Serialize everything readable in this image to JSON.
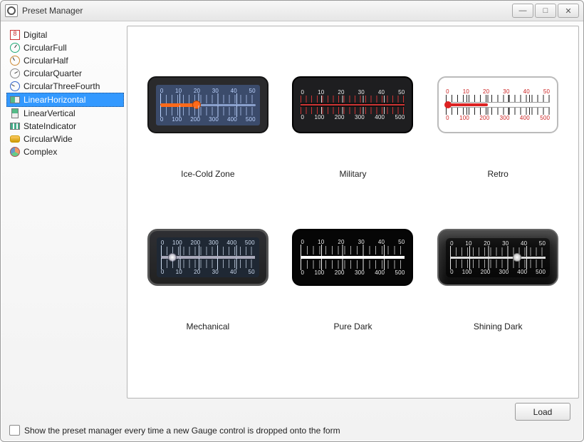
{
  "window": {
    "title": "Preset Manager"
  },
  "win_buttons": {
    "min": "—",
    "max": "□",
    "close": "✕"
  },
  "sidebar": {
    "items": [
      {
        "label": "Digital",
        "icon": "digital-icon"
      },
      {
        "label": "CircularFull",
        "icon": "circular-full-icon"
      },
      {
        "label": "CircularHalf",
        "icon": "circular-half-icon"
      },
      {
        "label": "CircularQuarter",
        "icon": "circular-quarter-icon"
      },
      {
        "label": "CircularThreeFourth",
        "icon": "circular-threefourth-icon"
      },
      {
        "label": "LinearHorizontal",
        "icon": "linear-horizontal-icon",
        "selected": true
      },
      {
        "label": "LinearVertical",
        "icon": "linear-vertical-icon"
      },
      {
        "label": "StateIndicator",
        "icon": "state-indicator-icon"
      },
      {
        "label": "CircularWide",
        "icon": "circular-wide-icon"
      },
      {
        "label": "Complex",
        "icon": "complex-icon"
      }
    ]
  },
  "presets": [
    {
      "name": "Ice-Cold Zone",
      "style": "ice",
      "scale_top": [
        "0",
        "10",
        "20",
        "30",
        "40",
        "50"
      ],
      "scale_bottom": [
        "0",
        "100",
        "200",
        "300",
        "400",
        "500"
      ],
      "value_pct": 38
    },
    {
      "name": "Military",
      "style": "military",
      "scale_top": [
        "0",
        "10",
        "20",
        "30",
        "40",
        "50"
      ],
      "scale_bottom": [
        "0",
        "100",
        "200",
        "300",
        "400",
        "500"
      ]
    },
    {
      "name": "Retro",
      "style": "retro",
      "scale_top": [
        "0",
        "10",
        "20",
        "30",
        "40",
        "50"
      ],
      "scale_bottom": [
        "0",
        "100",
        "200",
        "300",
        "400",
        "500"
      ],
      "value_pct": 40
    },
    {
      "name": "Mechanical",
      "style": "mechanical",
      "scale_top": [
        "0",
        "100",
        "200",
        "300",
        "400",
        "500"
      ],
      "scale_bottom": [
        "0",
        "10",
        "20",
        "30",
        "40",
        "50"
      ],
      "value_pct": 12
    },
    {
      "name": "Pure Dark",
      "style": "pure",
      "scale_top": [
        "0",
        "10",
        "20",
        "30",
        "40",
        "50"
      ],
      "scale_bottom": [
        "0",
        "100",
        "200",
        "300",
        "400",
        "500"
      ]
    },
    {
      "name": "Shining Dark",
      "style": "shine",
      "scale_top": [
        "0",
        "10",
        "20",
        "30",
        "40",
        "50"
      ],
      "scale_bottom": [
        "0",
        "100",
        "200",
        "300",
        "400",
        "500"
      ],
      "value_pct": 70
    }
  ],
  "footer": {
    "load_label": "Load",
    "checkbox_label": "Show the preset manager every time a new Gauge control is dropped onto the form",
    "checkbox_checked": false
  }
}
